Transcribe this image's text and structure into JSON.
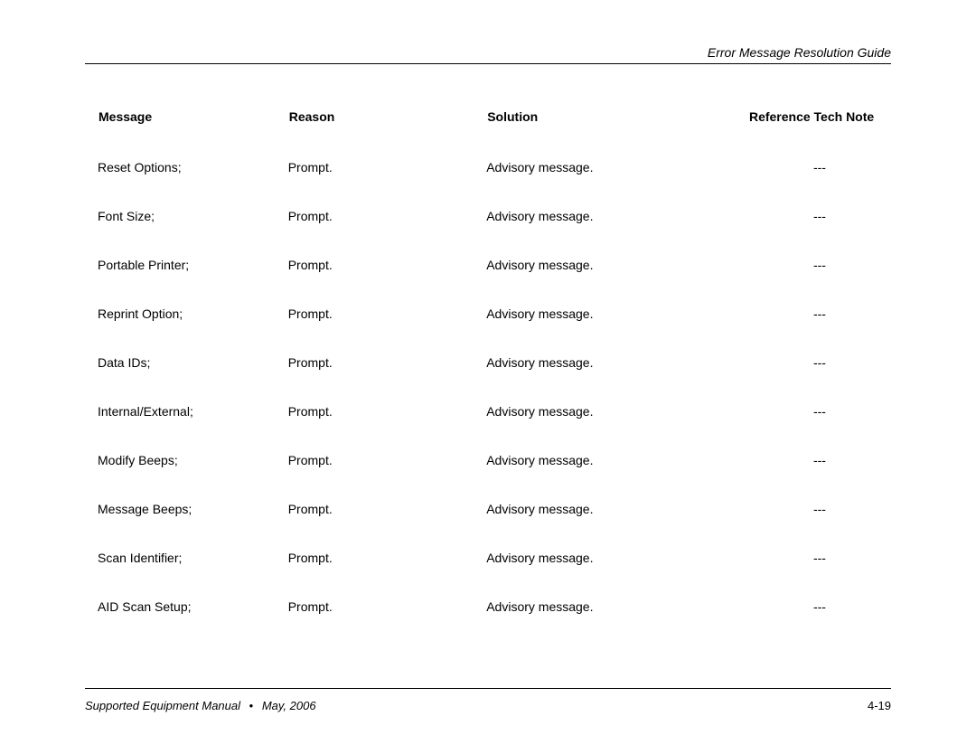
{
  "header": {
    "running_title": "Error Message Resolution Guide"
  },
  "table": {
    "headers": {
      "message": "Message",
      "reason": "Reason",
      "solution": "Solution",
      "reference": "Reference Tech Note"
    },
    "rows": [
      {
        "message": "Reset Options;",
        "reason": "Prompt.",
        "solution": "Advisory message.",
        "reference": "---"
      },
      {
        "message": "Font Size;",
        "reason": "Prompt.",
        "solution": "Advisory message.",
        "reference": "---"
      },
      {
        "message": "Portable Printer;",
        "reason": "Prompt.",
        "solution": "Advisory message.",
        "reference": "---"
      },
      {
        "message": "Reprint Option;",
        "reason": "Prompt.",
        "solution": "Advisory message.",
        "reference": "---"
      },
      {
        "message": "Data IDs;",
        "reason": "Prompt.",
        "solution": "Advisory message.",
        "reference": "---"
      },
      {
        "message": "Internal/External;",
        "reason": "Prompt.",
        "solution": "Advisory message.",
        "reference": "---"
      },
      {
        "message": "Modify Beeps;",
        "reason": "Prompt.",
        "solution": "Advisory message.",
        "reference": "---"
      },
      {
        "message": "Message Beeps;",
        "reason": "Prompt.",
        "solution": "Advisory message.",
        "reference": "---"
      },
      {
        "message": "Scan Identifier;",
        "reason": "Prompt.",
        "solution": "Advisory message.",
        "reference": "---"
      },
      {
        "message": "AID Scan Setup;",
        "reason": "Prompt.",
        "solution": "Advisory message.",
        "reference": "---"
      }
    ]
  },
  "footer": {
    "left_title": "Supported Equipment Manual",
    "bullet": "•",
    "left_date": "May, 2006",
    "page_number": "4-19"
  }
}
